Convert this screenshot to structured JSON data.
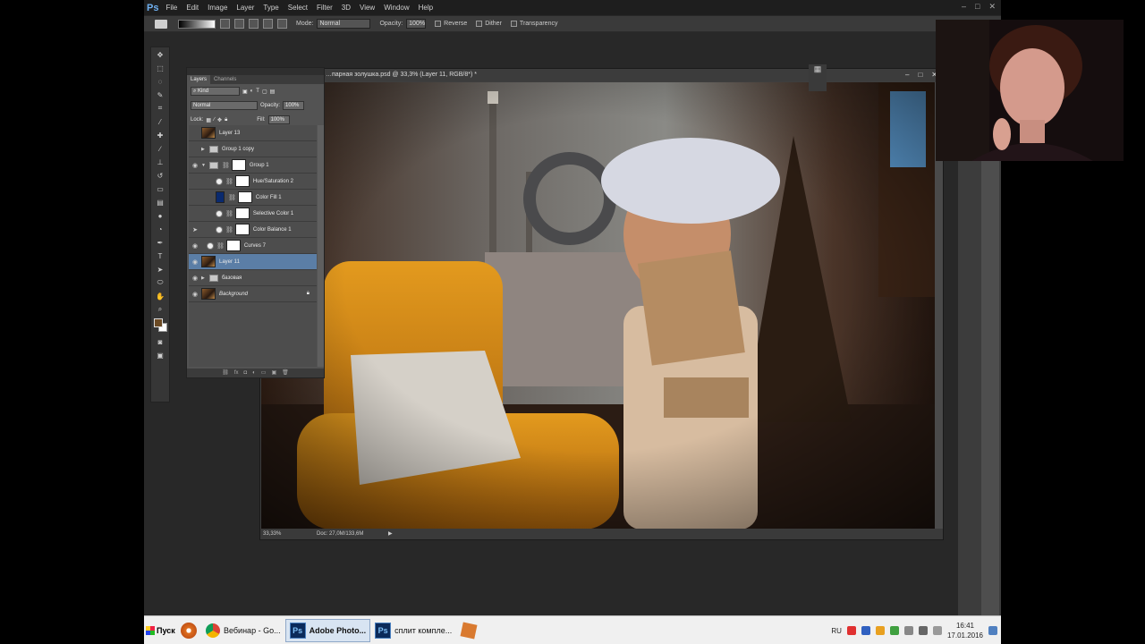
{
  "app": {
    "logo": "Ps",
    "menu": [
      "File",
      "Edit",
      "Image",
      "Layer",
      "Type",
      "Select",
      "Filter",
      "3D",
      "View",
      "Window",
      "Help"
    ],
    "window_controls": [
      "–",
      "□",
      "✕"
    ]
  },
  "options_bar": {
    "mode_label": "Mode:",
    "mode_value": "Normal",
    "opacity_label": "Opacity:",
    "opacity_value": "100%",
    "reverse": "Reverse",
    "dither": "Dither",
    "transparency": "Transparency"
  },
  "document": {
    "title": "…парная золушка.psd @ 33,3% (Layer 11, RGB/8*) *",
    "zoom": "33,33%",
    "doc_info": "Doc: 27,0M/133,6M",
    "controls": [
      "–",
      "□",
      "✕"
    ]
  },
  "layers_panel": {
    "tabs": [
      "Layers",
      "Channels"
    ],
    "filter_kind": "Kind",
    "blend_mode": "Normal",
    "opacity_label": "Opacity:",
    "opacity_value": "100%",
    "lock_label": "Lock:",
    "fill_label": "Fill:",
    "fill_value": "100%",
    "layers": [
      {
        "name": "Layer 13"
      },
      {
        "name": "Group 1 copy"
      },
      {
        "name": "Group 1"
      },
      {
        "name": "Hue/Saturation 2"
      },
      {
        "name": "Color Fill 1"
      },
      {
        "name": "Selective Color 1"
      },
      {
        "name": "Color Balance 1"
      },
      {
        "name": "Curves 7"
      },
      {
        "name": "Layer 11"
      },
      {
        "name": "базовая"
      },
      {
        "name": "Background"
      }
    ]
  },
  "taskbar": {
    "start_label": "Пуск",
    "tasks": [
      {
        "label": "Вебинар - Go..."
      },
      {
        "label": "Adobe Photo..."
      },
      {
        "label": "сплит компле..."
      }
    ],
    "language": "RU",
    "time": "16:41",
    "date": "17.01.2016"
  },
  "colors": {
    "ps_background": "#282828",
    "selection_blue": "#5b7ea6",
    "foreground_swatch": "#6b4a24",
    "accent_chair": "#d98a1a"
  }
}
